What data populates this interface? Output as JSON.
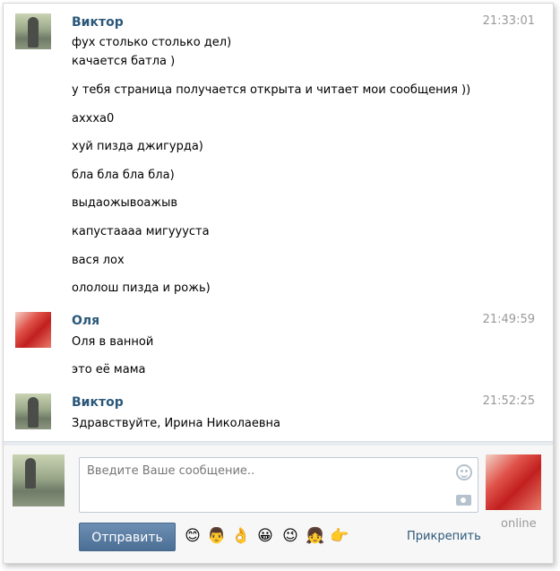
{
  "messages": [
    {
      "author": "Виктор",
      "time": "21:33:01",
      "avatar": "male-avatar",
      "lines": [
        "фух столько столько дел)",
        "качается батла )",
        "у тебя страница получается открыта и читает мои сообщения ))",
        "ахххa0",
        "хуй пизда джигурда)",
        "бла бла бла бла)",
        "выдаожывоажыв",
        "капустаааа мигуууста",
        "вася лох",
        "ололош пизда и рожь)"
      ]
    },
    {
      "author": "Оля",
      "time": "21:49:59",
      "avatar": "female-avatar",
      "lines": [
        "Оля в ванной",
        "это её мама"
      ]
    },
    {
      "author": "Виктор",
      "time": "21:52:25",
      "avatar": "male-avatar",
      "lines": [
        "Здравствуйте, Ирина Николаевна"
      ]
    }
  ],
  "composer": {
    "placeholder": "Введите Ваше сообщение..",
    "send_label": "Отправить",
    "attach_label": "Прикрепить",
    "status": "online",
    "emojis": [
      "😊",
      "👨",
      "👌",
      "😀",
      "😉",
      "👧",
      "👉"
    ]
  },
  "colors": {
    "name": "#2b587a",
    "time": "#999999",
    "send_button": "#5b7fa6"
  }
}
